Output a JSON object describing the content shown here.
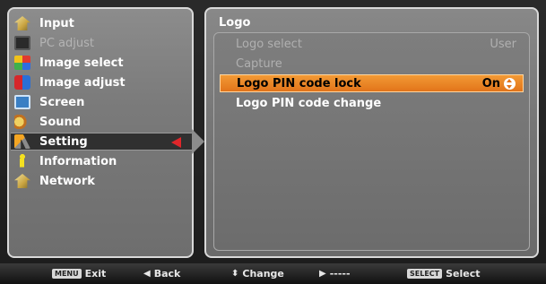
{
  "menu": {
    "items": [
      {
        "label": "Input",
        "icon": "input-icon",
        "disabled": false,
        "selected": false
      },
      {
        "label": "PC adjust",
        "icon": "pc-adjust-icon",
        "disabled": true,
        "selected": false
      },
      {
        "label": "Image select",
        "icon": "image-select-icon",
        "disabled": false,
        "selected": false
      },
      {
        "label": "Image adjust",
        "icon": "image-adjust-icon",
        "disabled": false,
        "selected": false
      },
      {
        "label": "Screen",
        "icon": "screen-icon",
        "disabled": false,
        "selected": false
      },
      {
        "label": "Sound",
        "icon": "sound-icon",
        "disabled": false,
        "selected": false
      },
      {
        "label": "Setting",
        "icon": "setting-icon",
        "disabled": false,
        "selected": true
      },
      {
        "label": "Information",
        "icon": "information-icon",
        "disabled": false,
        "selected": false
      },
      {
        "label": "Network",
        "icon": "network-icon",
        "disabled": false,
        "selected": false
      }
    ]
  },
  "submenu": {
    "title": "Logo",
    "items": [
      {
        "label": "Logo select",
        "value": "User",
        "disabled": true
      },
      {
        "label": "Capture",
        "value": "",
        "disabled": true
      },
      {
        "label": "Logo PIN code lock",
        "value": "On",
        "highlighted": true
      },
      {
        "label": "Logo PIN code change",
        "value": ""
      }
    ]
  },
  "footer": {
    "exit_key": "MENU",
    "exit_label": "Exit",
    "back_glyph": "◀",
    "back_label": "Back",
    "change_glyph": "⬍",
    "change_label": "Change",
    "next_glyph": "▶",
    "next_label": "-----",
    "select_key": "SELECT",
    "select_label": "Select"
  },
  "colors": {
    "highlight": "#e2741a",
    "selection_arrow": "#e0262a"
  }
}
